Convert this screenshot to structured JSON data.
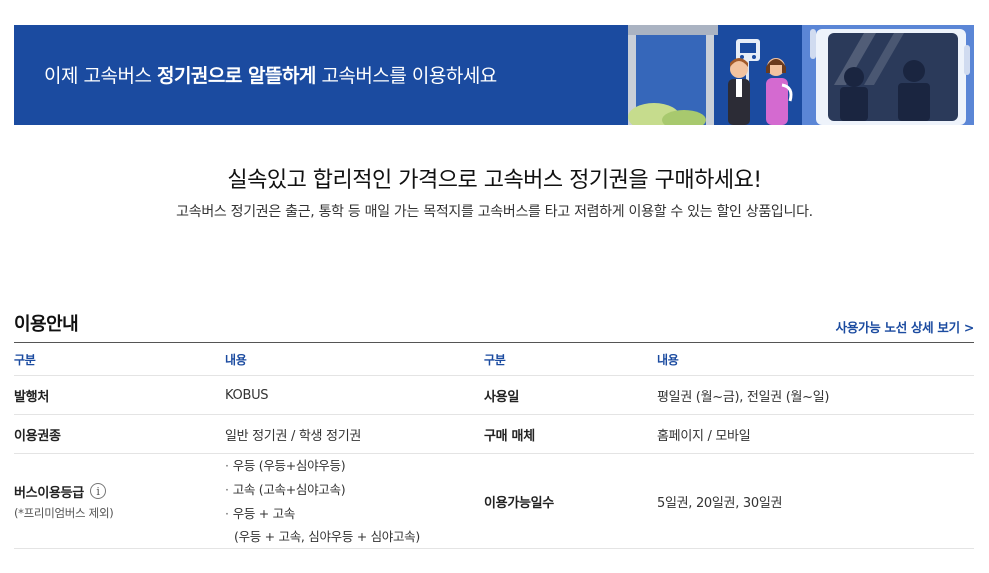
{
  "banner": {
    "text_pre": "이제 고속버스 ",
    "text_bold": "정기권으로 알뜰하게",
    "text_post": " 고속버스를 이용하세요"
  },
  "intro": {
    "headline": "실속있고 합리적인 가격으로 고속버스 정기권을 구매하세요!",
    "description": "고속버스 정기권은 출근, 통학 등 매일 가는 목적지를 고속버스를 타고 저렴하게 이용할 수 있는 할인 상품입니다."
  },
  "guide": {
    "title": "이용안내",
    "detail_link": "사용가능 노선 상세 보기",
    "detail_link_chevron": ">",
    "headers": [
      "구분",
      "내용",
      "구분",
      "내용"
    ],
    "rows": [
      {
        "label1": "발행처",
        "value1": "KOBUS",
        "label2": "사용일",
        "value2": "평일권 (월~금), 전일권 (월~일)"
      },
      {
        "label1": "이용권종",
        "value1": "일반 정기권 / 학생 정기권",
        "label2": "구매 매체",
        "value2": "홈페이지 / 모바일"
      }
    ],
    "grade_row": {
      "label": "버스이용등급",
      "info_icon": "i",
      "note": "(*프리미엄버스 제외)",
      "grades": [
        "우등 (우등+심야우등)",
        "고속 (고속+심야고속)",
        "우등 + 고속"
      ],
      "grade3_detail": "(우등 + 고속, 심야우등 + 심야고속)",
      "label2": "이용가능일수",
      "value2": "5일권, 20일권, 30일권"
    }
  },
  "colors": {
    "brand_blue": "#1b4ba0",
    "text_dark": "#222222",
    "divider": "#e4e4e4"
  }
}
